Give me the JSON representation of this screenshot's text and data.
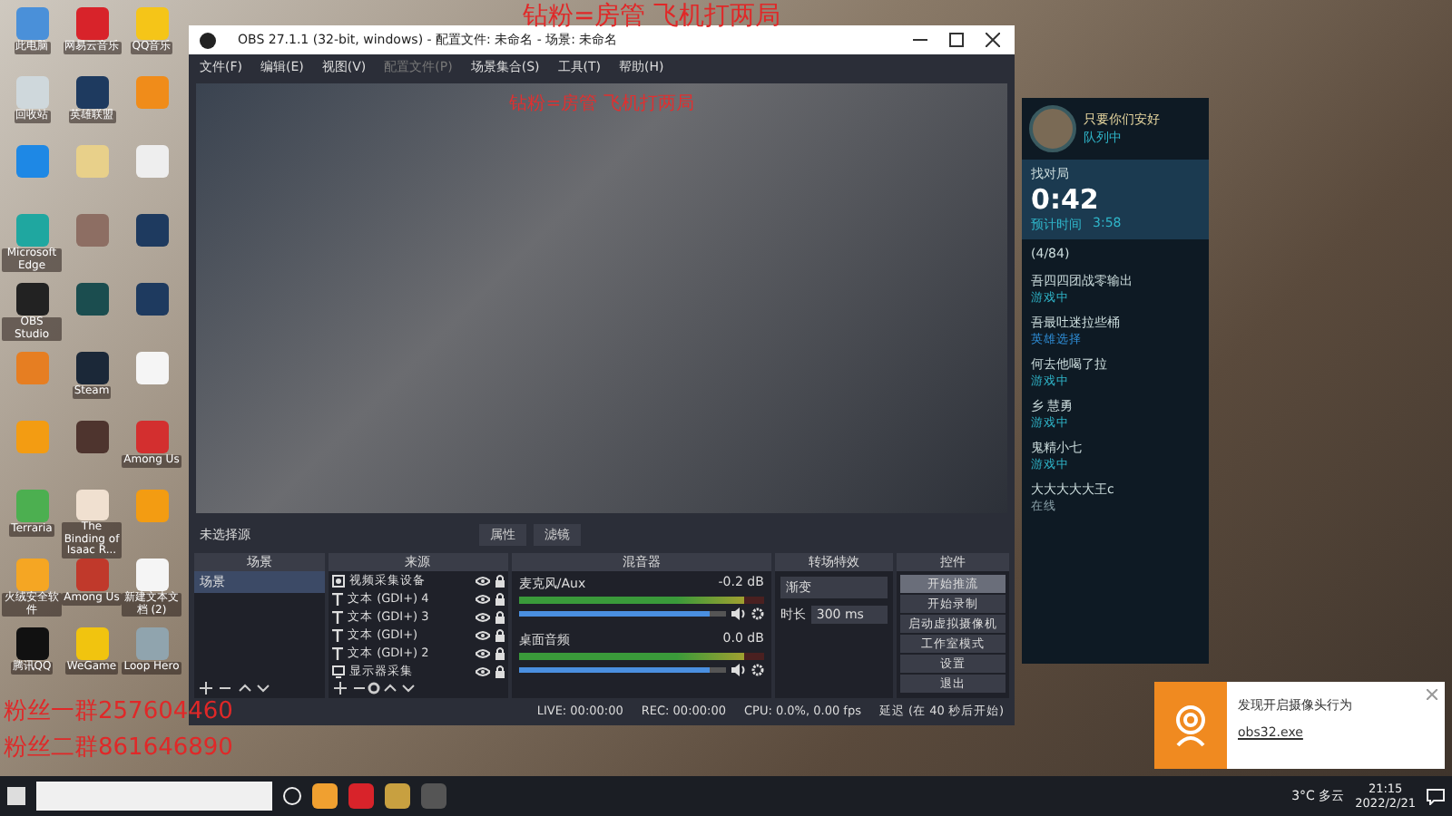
{
  "overlay_texts": {
    "banner": "钻粉=房管 飞机打两局",
    "fan_group_1": "粉丝一群257604460",
    "fan_group_2": "粉丝二群861646890"
  },
  "desktop_icons": [
    {
      "label": "此电脑",
      "color": "#4a90d9"
    },
    {
      "label": "网易云音乐",
      "color": "#d8232a"
    },
    {
      "label": "QQ音乐",
      "color": "#f5c518"
    },
    {
      "label": "回收站",
      "color": "#cfd8dc"
    },
    {
      "label": "英雄联盟",
      "color": "#1e3a5f"
    },
    {
      "color": "#f08c1a"
    },
    {
      "color": "#1e88e5"
    },
    {
      "color": "#e8d08a"
    },
    {
      "color": "#eeeeee"
    },
    {
      "label": "Microsoft Edge",
      "color": "#1fa7a0"
    },
    {
      "color": "#8d6e63"
    },
    {
      "color": "#1e3a5f"
    },
    {
      "label": "OBS Studio",
      "color": "#222222"
    },
    {
      "color": "#1b4d4f"
    },
    {
      "color": "#1e3a5f"
    },
    {
      "color": "#e67e22"
    },
    {
      "label": "Steam",
      "color": "#1b2838"
    },
    {
      "color": "#f5f5f5"
    },
    {
      "color": "#f39c12"
    },
    {
      "color": "#4e342e"
    },
    {
      "label": "Among Us",
      "color": "#d32f2f"
    },
    {
      "label": "Terraria",
      "color": "#4caf50"
    },
    {
      "label": "The Binding of Isaac R...",
      "color": "#f0e0d0"
    },
    {
      "color": "#f39c12"
    },
    {
      "label": "火绒安全软件",
      "color": "#f5a623"
    },
    {
      "label": "Among Us",
      "color": "#c0392b"
    },
    {
      "label": "新建文本文档 (2)",
      "color": "#f5f5f5"
    },
    {
      "label": "腾讯QQ",
      "color": "#111111"
    },
    {
      "label": "WeGame",
      "color": "#f1c40f"
    },
    {
      "label": "Loop Hero",
      "color": "#90a4ae"
    }
  ],
  "obs": {
    "window": {
      "title": "OBS 27.1.1 (32-bit, windows) - 配置文件: 未命名 - 场景: 未命名"
    },
    "menu": [
      {
        "label": "文件(F)",
        "disabled": false
      },
      {
        "label": "编辑(E)",
        "disabled": false
      },
      {
        "label": "视图(V)",
        "disabled": false
      },
      {
        "label": "配置文件(P)",
        "disabled": true
      },
      {
        "label": "场景集合(S)",
        "disabled": false
      },
      {
        "label": "工具(T)",
        "disabled": false
      },
      {
        "label": "帮助(H)",
        "disabled": false
      }
    ],
    "preview_banner": "钻粉=房管 飞机打两局",
    "source_toolbar": {
      "label": "未选择源",
      "buttons": [
        "属性",
        "滤镜"
      ]
    },
    "scenes": {
      "title": "场景",
      "items": [
        {
          "label": "场景",
          "selected": true
        }
      ]
    },
    "sources": {
      "title": "来源",
      "items": [
        {
          "kind": "video",
          "label": "视频采集设备",
          "visible": true
        },
        {
          "kind": "text",
          "label": "文本 (GDI+) 4",
          "visible": true
        },
        {
          "kind": "text",
          "label": "文本 (GDI+) 3",
          "visible": true
        },
        {
          "kind": "text",
          "label": "文本 (GDI+)",
          "visible": true
        },
        {
          "kind": "text",
          "label": "文本 (GDI+) 2",
          "visible": true
        },
        {
          "kind": "display",
          "label": "显示器采集",
          "visible": true
        }
      ]
    },
    "mixer": {
      "title": "混音器",
      "channels": [
        {
          "name": "麦克风/Aux",
          "reading": "-0.2 dB",
          "level": 0.92
        },
        {
          "name": "桌面音频",
          "reading": "0.0 dB",
          "level": 0.92
        }
      ]
    },
    "transitions": {
      "title": "转场特效",
      "type": "渐变",
      "duration_label": "时长",
      "duration": "300 ms"
    },
    "controls": {
      "title": "控件",
      "buttons": [
        {
          "label": "开始推流",
          "selected": true
        },
        {
          "label": "开始录制",
          "selected": false
        },
        {
          "label": "启动虚拟摄像机",
          "selected": false
        },
        {
          "label": "工作室模式",
          "selected": false
        },
        {
          "label": "设置",
          "selected": false
        },
        {
          "label": "退出",
          "selected": false
        }
      ]
    },
    "status_bar": {
      "live": "LIVE: 00:00:00",
      "rec": "REC: 00:00:00",
      "cpu": "CPU: 0.0%, 0.00 fps",
      "delay": "延迟 (在 40 秒后开始)"
    }
  },
  "game_client": {
    "user": {
      "name": "只要你们安好",
      "status": "队列中"
    },
    "queue": {
      "title": "找对局",
      "time": "0:42",
      "estimate_label": "预计时间",
      "estimate": "3:58"
    },
    "group": "(4/84)",
    "friends": [
      {
        "name": "吾四四团战零输出",
        "status": "游戏中",
        "color": "#2fb5c9"
      },
      {
        "name": "吾最吐迷拉些桶",
        "status": "英雄选择",
        "color": "#2f8fd9"
      },
      {
        "name": "何去他喝了拉",
        "status": "游戏中",
        "color": "#2fb5c9"
      },
      {
        "name": "乡 慧勇",
        "status": "游戏中",
        "color": "#2fb5c9"
      },
      {
        "name": "鬼精小七",
        "status": "游戏中",
        "color": "#2fb5c9"
      },
      {
        "name": "大大大大大王c",
        "status": "在线",
        "color": "#8aa0a8"
      }
    ]
  },
  "notification": {
    "message": "发现开启摄像头行为",
    "process": "obs32.exe"
  },
  "taskbar": {
    "weather": "3°C 多云",
    "time": "21:15",
    "date": "2022/2/21"
  }
}
